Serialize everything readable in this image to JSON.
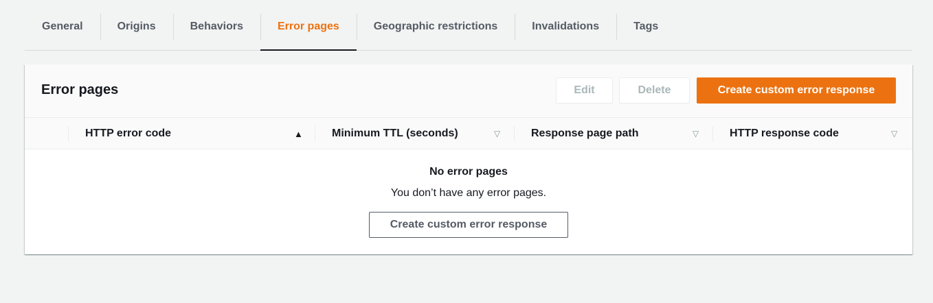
{
  "tabs": [
    {
      "label": "General",
      "active": false
    },
    {
      "label": "Origins",
      "active": false
    },
    {
      "label": "Behaviors",
      "active": false
    },
    {
      "label": "Error pages",
      "active": true
    },
    {
      "label": "Geographic restrictions",
      "active": false
    },
    {
      "label": "Invalidations",
      "active": false
    },
    {
      "label": "Tags",
      "active": false
    }
  ],
  "panel": {
    "title": "Error pages",
    "edit_label": "Edit",
    "delete_label": "Delete",
    "create_label": "Create custom error response"
  },
  "table": {
    "columns": [
      {
        "label": "HTTP error code",
        "sort": "ascending"
      },
      {
        "label": "Minimum TTL (seconds)",
        "sort": "none"
      },
      {
        "label": "Response page path",
        "sort": "none"
      },
      {
        "label": "HTTP response code",
        "sort": "none"
      }
    ],
    "sort_icons": {
      "ascending": "▲",
      "none": "▽"
    }
  },
  "empty_state": {
    "title": "No error pages",
    "message": "You don’t have any error pages.",
    "button_label": "Create custom error response"
  },
  "colors": {
    "accent": "#ec7211",
    "background": "#f2f3f3",
    "text": "#16191f",
    "muted": "#545b64"
  },
  "icons": {
    "sort_ascending": "caret-up-icon",
    "sort_none": "caret-down-outline-icon"
  }
}
